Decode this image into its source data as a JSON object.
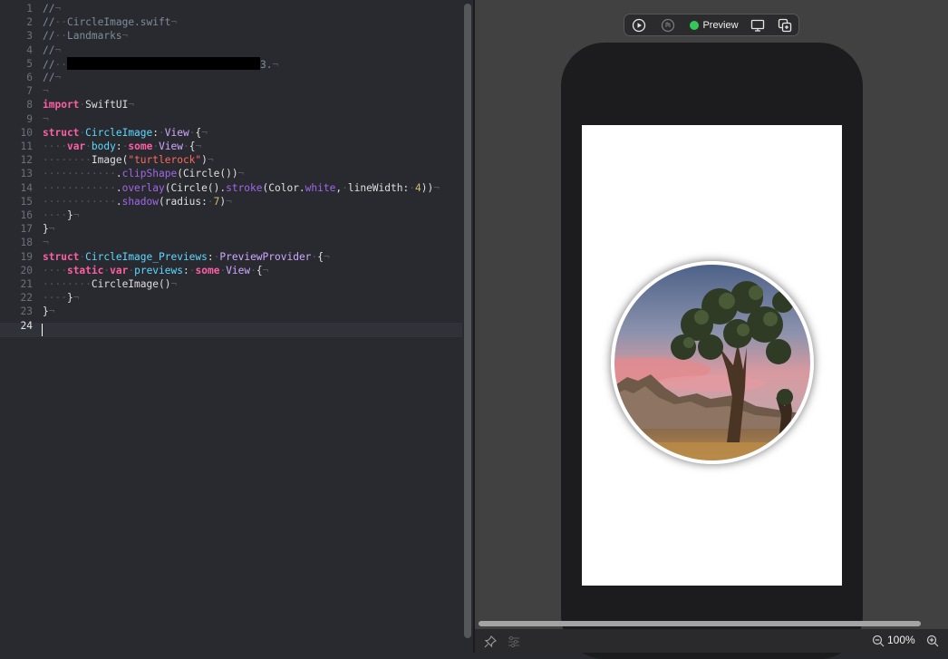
{
  "editor": {
    "lines": [
      {
        "n": "1",
        "tokens": [
          {
            "t": "//",
            "c": "cmt"
          },
          {
            "t": "¬",
            "c": "inv"
          }
        ]
      },
      {
        "n": "2",
        "tokens": [
          {
            "t": "//",
            "c": "cmt"
          },
          {
            "t": "··",
            "c": "inv"
          },
          {
            "t": "CircleImage.swift",
            "c": "cmt"
          },
          {
            "t": "¬",
            "c": "inv"
          }
        ]
      },
      {
        "n": "3",
        "tokens": [
          {
            "t": "//",
            "c": "cmt"
          },
          {
            "t": "··",
            "c": "inv"
          },
          {
            "t": "Landmarks",
            "c": "cmt"
          },
          {
            "t": "¬",
            "c": "inv"
          }
        ]
      },
      {
        "n": "4",
        "tokens": [
          {
            "t": "//",
            "c": "cmt"
          },
          {
            "t": "¬",
            "c": "inv"
          }
        ]
      },
      {
        "n": "5",
        "tokens": [
          {
            "t": "//",
            "c": "cmt"
          },
          {
            "t": "··",
            "c": "inv"
          },
          {
            "t": "",
            "c": "redact"
          },
          {
            "t": "3.",
            "c": "cmt"
          },
          {
            "t": "¬",
            "c": "inv"
          }
        ]
      },
      {
        "n": "6",
        "tokens": [
          {
            "t": "//",
            "c": "cmt"
          },
          {
            "t": "¬",
            "c": "inv"
          }
        ]
      },
      {
        "n": "7",
        "tokens": [
          {
            "t": "¬",
            "c": "inv"
          }
        ]
      },
      {
        "n": "8",
        "tokens": [
          {
            "t": "import",
            "c": "kw"
          },
          {
            "t": "·",
            "c": "inv"
          },
          {
            "t": "SwiftUI",
            "c": "plain"
          },
          {
            "t": "¬",
            "c": "inv"
          }
        ]
      },
      {
        "n": "9",
        "tokens": [
          {
            "t": "¬",
            "c": "inv"
          }
        ]
      },
      {
        "n": "10",
        "tokens": [
          {
            "t": "struct",
            "c": "kw"
          },
          {
            "t": "·",
            "c": "inv"
          },
          {
            "t": "CircleImage",
            "c": "type"
          },
          {
            "t": ":",
            "c": "plain"
          },
          {
            "t": "·",
            "c": "inv"
          },
          {
            "t": "View",
            "c": "type2"
          },
          {
            "t": "·",
            "c": "inv"
          },
          {
            "t": "{",
            "c": "plain"
          },
          {
            "t": "¬",
            "c": "inv"
          }
        ]
      },
      {
        "n": "11",
        "tokens": [
          {
            "t": "····",
            "c": "inv"
          },
          {
            "t": "var",
            "c": "kw"
          },
          {
            "t": "·",
            "c": "inv"
          },
          {
            "t": "body",
            "c": "type"
          },
          {
            "t": ":",
            "c": "plain"
          },
          {
            "t": "·",
            "c": "inv"
          },
          {
            "t": "some",
            "c": "kw"
          },
          {
            "t": "·",
            "c": "inv"
          },
          {
            "t": "View",
            "c": "type2"
          },
          {
            "t": "·",
            "c": "inv"
          },
          {
            "t": "{",
            "c": "plain"
          },
          {
            "t": "¬",
            "c": "inv"
          }
        ]
      },
      {
        "n": "12",
        "tokens": [
          {
            "t": "········",
            "c": "inv"
          },
          {
            "t": "Image",
            "c": "plain"
          },
          {
            "t": "(",
            "c": "plain"
          },
          {
            "t": "\"turtlerock\"",
            "c": "str"
          },
          {
            "t": ")",
            "c": "plain"
          },
          {
            "t": "¬",
            "c": "inv"
          }
        ]
      },
      {
        "n": "13",
        "tokens": [
          {
            "t": "············",
            "c": "inv"
          },
          {
            "t": ".",
            "c": "plain"
          },
          {
            "t": "clipShape",
            "c": "fn"
          },
          {
            "t": "(Circle())",
            "c": "plain"
          },
          {
            "t": "¬",
            "c": "inv"
          }
        ]
      },
      {
        "n": "14",
        "tokens": [
          {
            "t": "············",
            "c": "inv"
          },
          {
            "t": ".",
            "c": "plain"
          },
          {
            "t": "overlay",
            "c": "fn"
          },
          {
            "t": "(Circle().",
            "c": "plain"
          },
          {
            "t": "stroke",
            "c": "fn"
          },
          {
            "t": "(Color.",
            "c": "plain"
          },
          {
            "t": "white",
            "c": "fn"
          },
          {
            "t": ",",
            "c": "plain"
          },
          {
            "t": "·",
            "c": "inv"
          },
          {
            "t": "lineWidth:",
            "c": "plain"
          },
          {
            "t": "·",
            "c": "inv"
          },
          {
            "t": "4",
            "c": "num"
          },
          {
            "t": "))",
            "c": "plain"
          },
          {
            "t": "¬",
            "c": "inv"
          }
        ]
      },
      {
        "n": "15",
        "tokens": [
          {
            "t": "············",
            "c": "inv"
          },
          {
            "t": ".",
            "c": "plain"
          },
          {
            "t": "shadow",
            "c": "fn"
          },
          {
            "t": "(radius:",
            "c": "plain"
          },
          {
            "t": "·",
            "c": "inv"
          },
          {
            "t": "7",
            "c": "num"
          },
          {
            "t": ")",
            "c": "plain"
          },
          {
            "t": "¬",
            "c": "inv"
          }
        ]
      },
      {
        "n": "16",
        "tokens": [
          {
            "t": "····",
            "c": "inv"
          },
          {
            "t": "}",
            "c": "plain"
          },
          {
            "t": "¬",
            "c": "inv"
          }
        ]
      },
      {
        "n": "17",
        "tokens": [
          {
            "t": "}",
            "c": "plain"
          },
          {
            "t": "¬",
            "c": "inv"
          }
        ]
      },
      {
        "n": "18",
        "tokens": [
          {
            "t": "¬",
            "c": "inv"
          }
        ]
      },
      {
        "n": "19",
        "tokens": [
          {
            "t": "struct",
            "c": "kw"
          },
          {
            "t": "·",
            "c": "inv"
          },
          {
            "t": "CircleImage_Previews",
            "c": "type"
          },
          {
            "t": ":",
            "c": "plain"
          },
          {
            "t": "·",
            "c": "inv"
          },
          {
            "t": "PreviewProvider",
            "c": "type2"
          },
          {
            "t": "·",
            "c": "inv"
          },
          {
            "t": "{",
            "c": "plain"
          },
          {
            "t": "¬",
            "c": "inv"
          }
        ]
      },
      {
        "n": "20",
        "tokens": [
          {
            "t": "····",
            "c": "inv"
          },
          {
            "t": "static",
            "c": "kw"
          },
          {
            "t": "·",
            "c": "inv"
          },
          {
            "t": "var",
            "c": "kw"
          },
          {
            "t": "·",
            "c": "inv"
          },
          {
            "t": "previews",
            "c": "type"
          },
          {
            "t": ":",
            "c": "plain"
          },
          {
            "t": "·",
            "c": "inv"
          },
          {
            "t": "some",
            "c": "kw"
          },
          {
            "t": "·",
            "c": "inv"
          },
          {
            "t": "View",
            "c": "type2"
          },
          {
            "t": "·",
            "c": "inv"
          },
          {
            "t": "{",
            "c": "plain"
          },
          {
            "t": "¬",
            "c": "inv"
          }
        ]
      },
      {
        "n": "21",
        "tokens": [
          {
            "t": "········",
            "c": "inv"
          },
          {
            "t": "CircleImage",
            "c": "plain"
          },
          {
            "t": "()",
            "c": "plain"
          },
          {
            "t": "¬",
            "c": "inv"
          }
        ]
      },
      {
        "n": "22",
        "tokens": [
          {
            "t": "····",
            "c": "inv"
          },
          {
            "t": "}",
            "c": "plain"
          },
          {
            "t": "¬",
            "c": "inv"
          }
        ]
      },
      {
        "n": "23",
        "tokens": [
          {
            "t": "}",
            "c": "plain"
          },
          {
            "t": "¬",
            "c": "inv"
          }
        ]
      },
      {
        "n": "24",
        "tokens": []
      }
    ],
    "current_line": "24"
  },
  "canvas": {
    "toolbar": {
      "live_icon": "play-circle-icon",
      "select_icon": "selectable-circle-icon",
      "preview_label": "Preview",
      "device_icon": "device-settings-icon",
      "duplicate_icon": "duplicate-preview-icon"
    },
    "preview_image": {
      "name": "turtlerock",
      "icon": "turtlerock-photo"
    },
    "bottom_bar": {
      "pin_icon": "pin-icon",
      "settings_icon": "adjust-sliders-icon",
      "zoom_out_icon": "zoom-out-icon",
      "zoom_level": "100%",
      "zoom_in_icon": "zoom-in-icon"
    }
  },
  "colors": {
    "editor_bg": "#292a30",
    "keyword": "#fc5fa3",
    "type": "#5dd8ff",
    "type_decl": "#d0a8ff",
    "string": "#fc6a5d",
    "number": "#d0bf69",
    "function": "#a167e6",
    "comment": "#7f8c98",
    "canvas_bg": "#414141",
    "preview_dot": "#34c759"
  }
}
